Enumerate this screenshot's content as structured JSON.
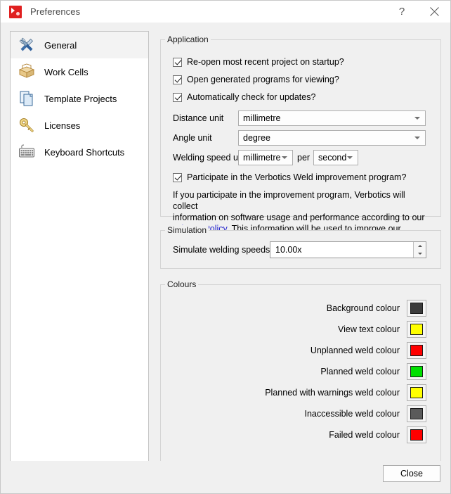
{
  "window": {
    "title": "Preferences",
    "icon": "verbotics-logo-icon",
    "help_button": "?",
    "close_button": "✕"
  },
  "sidebar": {
    "items": [
      {
        "label": "General",
        "icon": "tools-icon",
        "selected": true
      },
      {
        "label": "Work Cells",
        "icon": "box-icon",
        "selected": false
      },
      {
        "label": "Template Projects",
        "icon": "documents-icon",
        "selected": false
      },
      {
        "label": "Licenses",
        "icon": "key-icon",
        "selected": false
      },
      {
        "label": "Keyboard Shortcuts",
        "icon": "keyboard-icon",
        "selected": false
      }
    ]
  },
  "application": {
    "title": "Application",
    "checkboxes": [
      {
        "label": "Re-open most recent project on startup?",
        "checked": true
      },
      {
        "label": "Open generated programs for viewing?",
        "checked": true
      },
      {
        "label": "Automatically check for updates?",
        "checked": true
      }
    ],
    "distance_unit": {
      "label": "Distance unit",
      "value": "millimetre"
    },
    "angle_unit": {
      "label": "Angle unit",
      "value": "degree"
    },
    "welding_speed_unit": {
      "label": "Welding speed unit",
      "value": "millimetre",
      "per_label": "per",
      "per_value": "second"
    },
    "improvement_checkbox": {
      "label": "Participate in the Verbotics Weld improvement program?",
      "checked": true
    },
    "info_line1": "If you participate in the improvement program, Verbotics will collect",
    "info_line2": "information on software usage and performance according to our",
    "info_link": "Privacy Policy",
    "info_line3": ". This information will be used to improve our software."
  },
  "simulation": {
    "title": "Simulation",
    "speed_label": "Simulate welding speeds at",
    "speed_value": "10.00x"
  },
  "colours": {
    "title": "Colours",
    "rows": [
      {
        "label": "Background colour",
        "color": "#3c3c3c"
      },
      {
        "label": "View text colour",
        "color": "#ffff00"
      },
      {
        "label": "Unplanned weld colour",
        "color": "#ff0000"
      },
      {
        "label": "Planned weld colour",
        "color": "#00e000"
      },
      {
        "label": "Planned with warnings weld colour",
        "color": "#ffff00"
      },
      {
        "label": "Inaccessible weld colour",
        "color": "#5a5a5a"
      },
      {
        "label": "Failed weld colour",
        "color": "#ff0000"
      }
    ]
  },
  "footer": {
    "close_label": "Close"
  }
}
